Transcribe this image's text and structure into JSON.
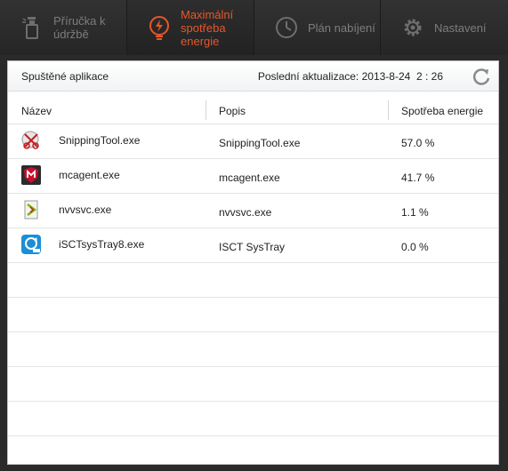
{
  "nav": {
    "tabs": [
      {
        "label_line1": "Příručka k",
        "label_line2": "údržbě",
        "icon": "spray-bottle-icon"
      },
      {
        "label_line1": "Maximální",
        "label_line2": "spotřeba",
        "label_line3": "energie",
        "icon": "power-bulb-icon",
        "active": true
      },
      {
        "label_line1": "Plán nabíjení",
        "icon": "clock-icon"
      },
      {
        "label_line1": "Nastavení",
        "icon": "gear-icon"
      }
    ]
  },
  "panel": {
    "title": "Spuštěné aplikace",
    "last_update_label": "Poslední aktualizace:",
    "last_update_value": "2013-8-24  2 : 26",
    "refresh_icon": "refresh-icon"
  },
  "table": {
    "columns": [
      "Název",
      "Popis",
      "Spotřeba energie"
    ],
    "rows": [
      {
        "name": "SnippingTool.exe",
        "desc": "SnippingTool.exe",
        "energy": "57.0 %",
        "icon": "snipping-tool-icon"
      },
      {
        "name": "mcagent.exe",
        "desc": "mcagent.exe",
        "energy": "41.7 %",
        "icon": "mcafee-shield-icon"
      },
      {
        "name": "nvvsvc.exe",
        "desc": "nvvsvc.exe",
        "energy": "1.1 %",
        "icon": "nvidia-app-icon"
      },
      {
        "name": "iSCTsysTray8.exe",
        "desc": "ISCT SysTray",
        "energy": "0.0 %",
        "icon": "intel-isct-icon"
      }
    ]
  },
  "colors": {
    "accent": "#e8562a",
    "inactive_tab_text": "#7d7d7d",
    "topbar_bg": "#2a2a2a"
  }
}
